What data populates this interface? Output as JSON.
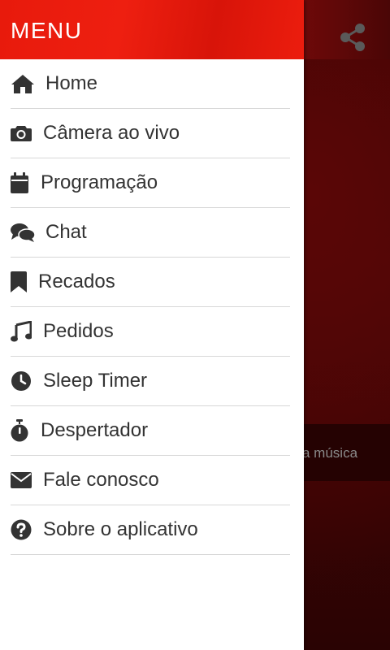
{
  "drawer": {
    "title": "MENU",
    "accent_color": "#e81a0c",
    "items": [
      {
        "label": "Home",
        "icon": "home-icon"
      },
      {
        "label": "Câmera ao vivo",
        "icon": "camera-icon"
      },
      {
        "label": "Programação",
        "icon": "calendar-icon"
      },
      {
        "label": "Chat",
        "icon": "chat-icon"
      },
      {
        "label": "Recados",
        "icon": "bookmark-icon"
      },
      {
        "label": "Pedidos",
        "icon": "music-icon"
      },
      {
        "label": "Sleep Timer",
        "icon": "clock-icon"
      },
      {
        "label": "Despertador",
        "icon": "stopwatch-icon"
      },
      {
        "label": "Fale conosco",
        "icon": "envelope-icon"
      },
      {
        "label": "Sobre o aplicativo",
        "icon": "question-icon"
      }
    ]
  },
  "background": {
    "now_playing_text": "a música",
    "share_icon": "share-icon"
  }
}
